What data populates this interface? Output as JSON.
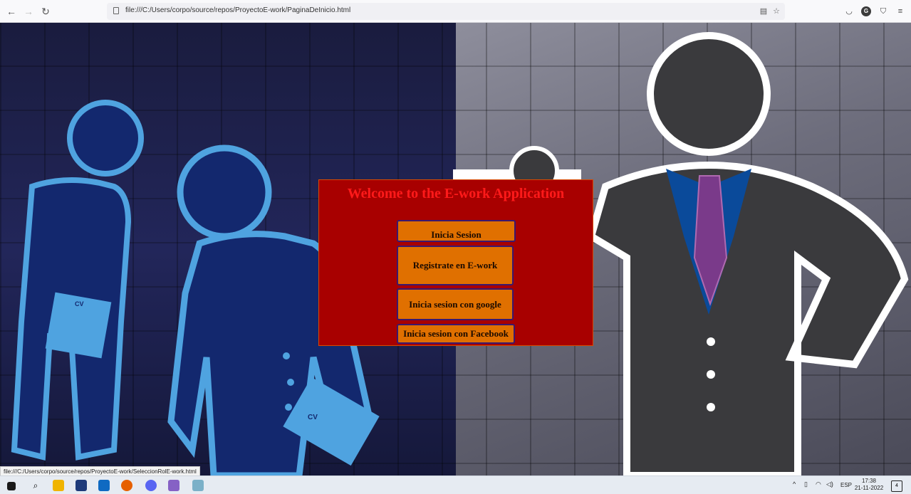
{
  "browser": {
    "url": "file:///C:/Users/corpo/source/repos/ProyectoE-work/PaginaDeInicio.html",
    "status_link": "file:///C:/Users/corpo/source/repos/ProyectoE-work/SeleccionRolE-work.html"
  },
  "modal": {
    "title": "Welcome to the E-work Application",
    "buttons": {
      "login": "Inicia Sesion",
      "register": "Registrate en E-work",
      "google": "Inicia sesion con google",
      "facebook": "Inicia sesion con Facebook"
    }
  },
  "taskbar": {
    "language": "ESP",
    "time": "17:38",
    "date": "21-11-2022",
    "notification_count": "4"
  },
  "artwork": {
    "cv_label_1": "CV",
    "cv_label_2": "CV"
  },
  "colors": {
    "modal_bg": "#a80000",
    "title": "#ff1a1a",
    "button_bg": "#e07000",
    "button_border": "#3a1870"
  }
}
